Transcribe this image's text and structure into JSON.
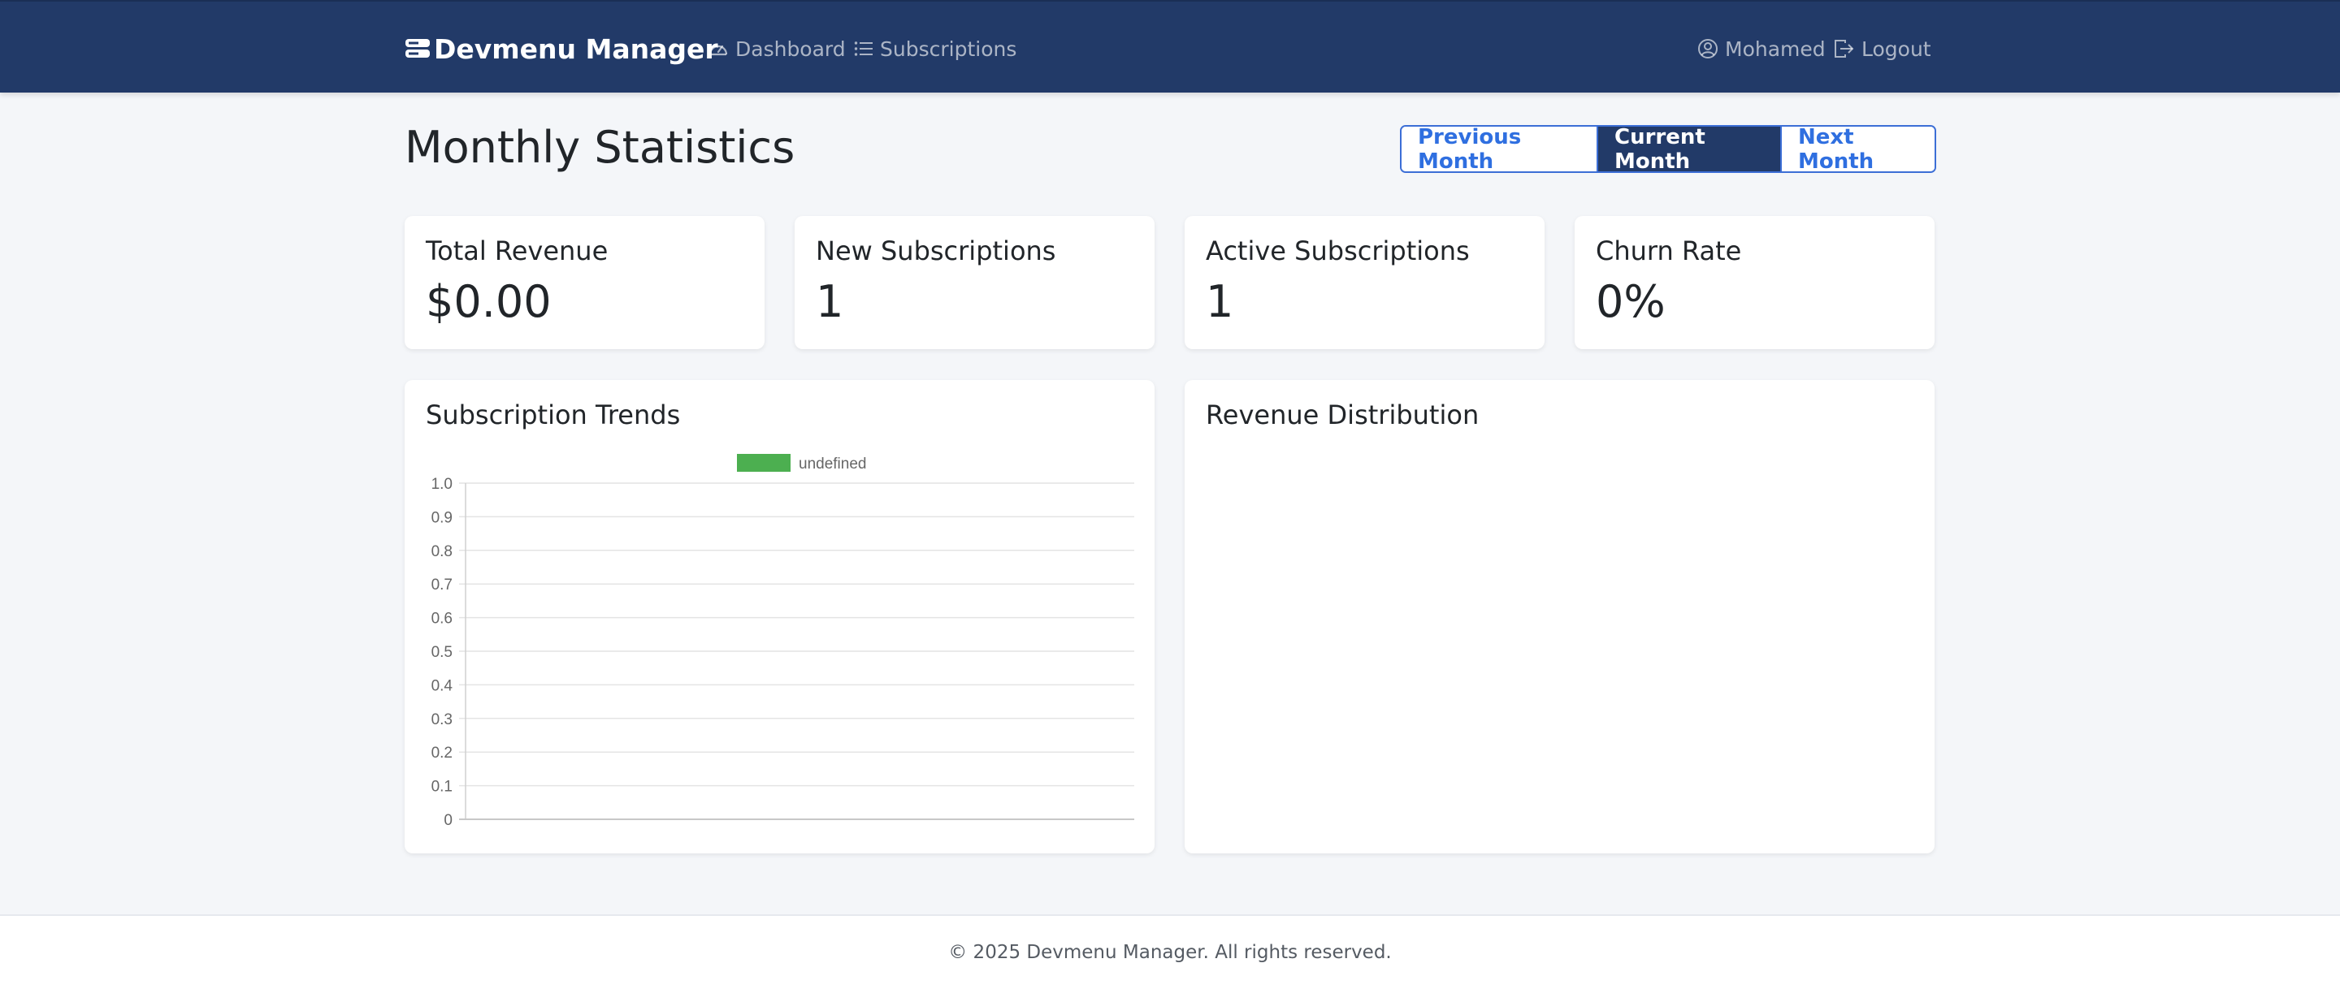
{
  "navbar": {
    "brand": "Devmenu Manager",
    "links": {
      "dashboard": "Dashboard",
      "subscriptions": "Subscriptions"
    },
    "user": "Mohamed",
    "logout": "Logout"
  },
  "page": {
    "title": "Monthly Statistics",
    "period_buttons": {
      "previous": "Previous Month",
      "current": "Current Month",
      "next": "Next Month"
    }
  },
  "stats": [
    {
      "label": "Total Revenue",
      "value": "$0.00"
    },
    {
      "label": "New Subscriptions",
      "value": "1"
    },
    {
      "label": "Active Subscriptions",
      "value": "1"
    },
    {
      "label": "Churn Rate",
      "value": "0%"
    }
  ],
  "charts": {
    "trends_title": "Subscription Trends",
    "distribution_title": "Revenue Distribution"
  },
  "chart_data": {
    "type": "bar",
    "title": "Subscription Trends",
    "categories": [],
    "series": [
      {
        "name": "undefined",
        "values": []
      }
    ],
    "ylim": [
      0,
      1.0
    ],
    "yticks": [
      "1.0",
      "0.9",
      "0.8",
      "0.7",
      "0.6",
      "0.5",
      "0.4",
      "0.3",
      "0.2",
      "0.1",
      "0"
    ],
    "grid": true,
    "legend": "top-center",
    "series_color": "#4caf50"
  },
  "footer": {
    "text": "© 2025 Devmenu Manager. All rights reserved."
  }
}
